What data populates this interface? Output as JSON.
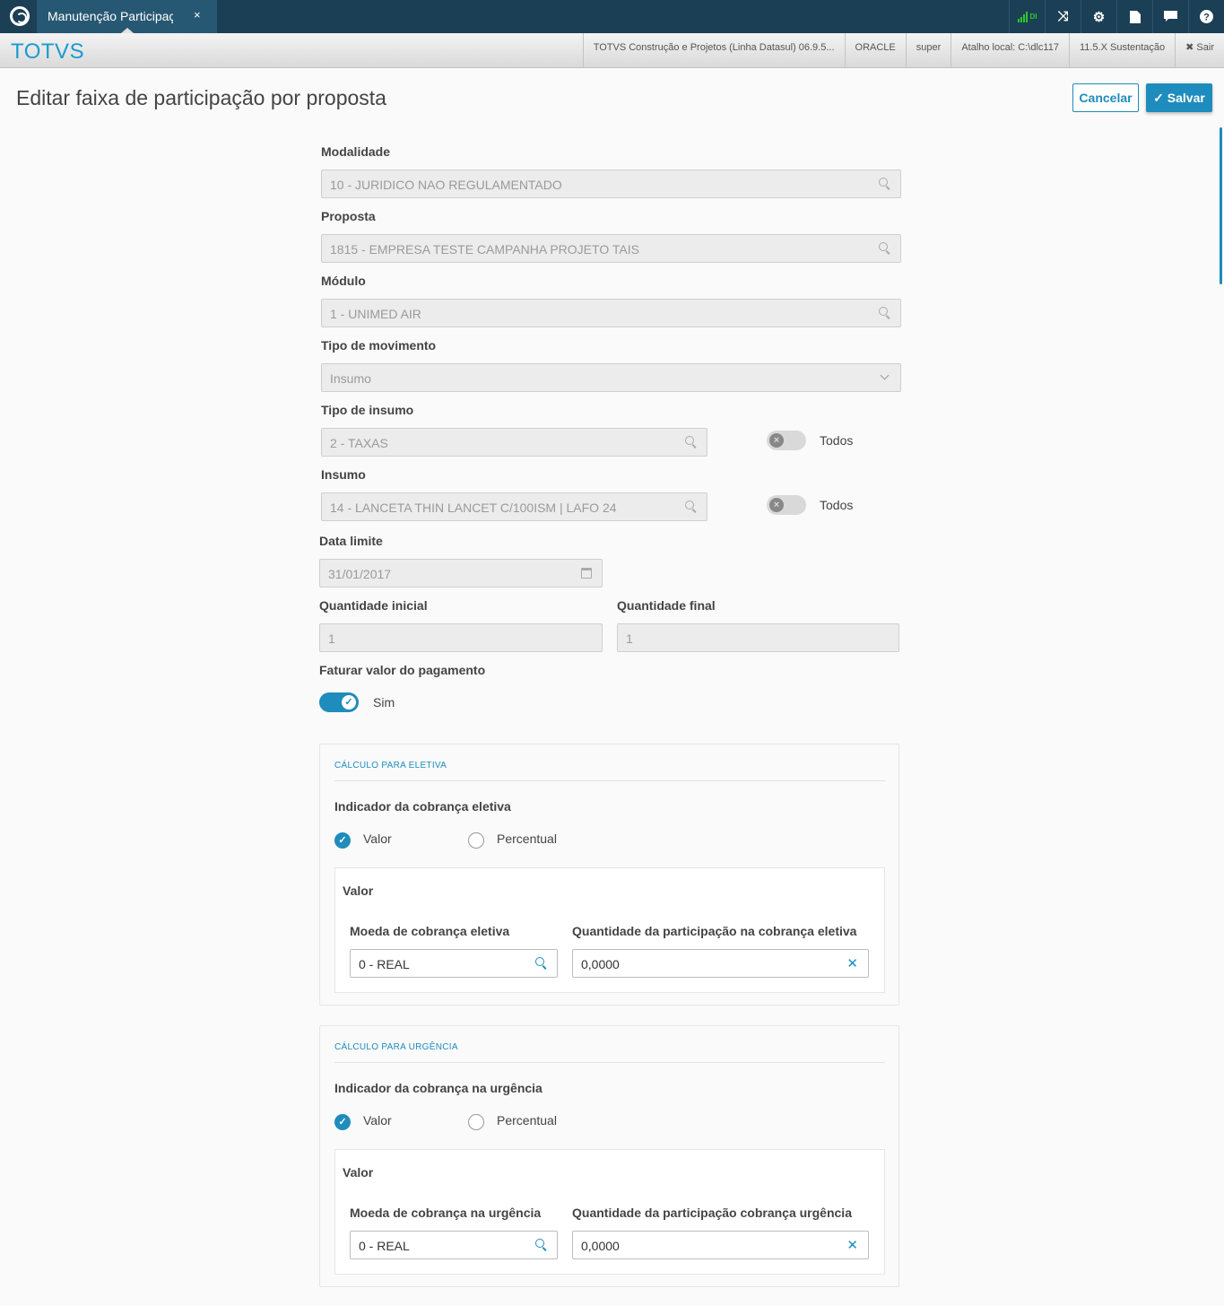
{
  "topbar": {
    "tab_label": "Manutenção Participaç",
    "tab_close": "×",
    "signal_label": "DI",
    "icons": [
      "shuffle-icon",
      "gear-icon",
      "document-icon",
      "chat-icon",
      "help-icon"
    ]
  },
  "brandbar": {
    "brand": "TOTVS",
    "cells": [
      "TOTVS Construção e Projetos (Linha Datasul) 06.9.5...",
      "ORACLE",
      "super",
      "Atalho local: C:\\dlc117",
      "11.5.X Sustentação",
      "✖ Sair"
    ]
  },
  "page": {
    "title": "Editar faixa de participação por proposta",
    "cancel_label": "Cancelar",
    "save_label": "✓ Salvar"
  },
  "form": {
    "modalidade": {
      "label": "Modalidade",
      "value": "10 - JURIDICO NAO REGULAMENTADO"
    },
    "proposta": {
      "label": "Proposta",
      "value": "1815 - EMPRESA TESTE CAMPANHA PROJETO TAIS"
    },
    "modulo": {
      "label": "Módulo",
      "value": "1 - UNIMED AIR"
    },
    "tipo_movimento": {
      "label": "Tipo de movimento",
      "value": "Insumo"
    },
    "tipo_insumo": {
      "label": "Tipo de insumo",
      "value": "2 - TAXAS",
      "toggle_label": "Todos",
      "toggle_on": false
    },
    "insumo": {
      "label": "Insumo",
      "value": "14 - LANCETA THIN LANCET C/100ISM | LAFO 24",
      "toggle_label": "Todos",
      "toggle_on": false
    },
    "data_limite": {
      "label": "Data limite",
      "value": "31/01/2017"
    },
    "qtd_inicial": {
      "label": "Quantidade inicial",
      "value": "1"
    },
    "qtd_final": {
      "label": "Quantidade final",
      "value": "1"
    },
    "faturar": {
      "label": "Faturar valor do pagamento",
      "toggle_label": "Sim",
      "toggle_on": true
    }
  },
  "eletiva": {
    "section_title": "CÁLCULO PARA ELETIVA",
    "indicator_label": "Indicador da cobrança eletiva",
    "option_valor": "Valor",
    "option_percentual": "Percentual",
    "selected": "Valor",
    "sub_title": "Valor",
    "moeda_label": "Moeda de cobrança eletiva",
    "moeda_value": "0 - REAL",
    "qtd_label": "Quantidade da participação na cobrança eletiva",
    "qtd_value": "0,0000"
  },
  "urgencia": {
    "section_title": "CÁLCULO PARA URGÊNCIA",
    "indicator_label": "Indicador da cobrança na urgência",
    "option_valor": "Valor",
    "option_percentual": "Percentual",
    "selected": "Valor",
    "sub_title": "Valor",
    "moeda_label": "Moeda de cobrança na urgência",
    "moeda_value": "0 - REAL",
    "qtd_label": "Quantidade da participação cobrança urgência",
    "qtd_value": "0,0000"
  },
  "colors": {
    "accent": "#1e8cbc",
    "topbar": "#1b3f55",
    "tab": "#275873",
    "brand": "#1a9bd0",
    "signal": "#2dc82d"
  }
}
